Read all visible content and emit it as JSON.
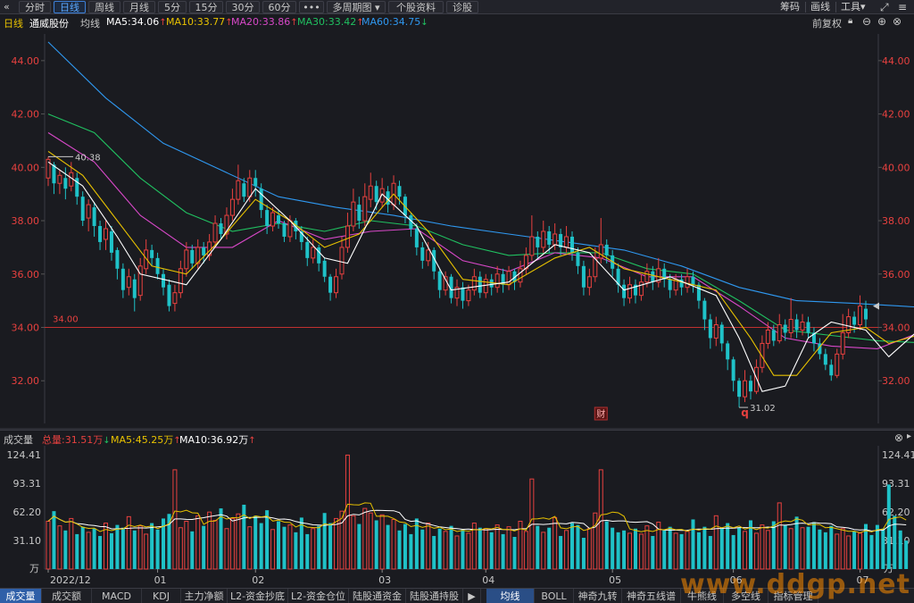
{
  "toolbar": {
    "back_icon": "«",
    "periods": [
      "分时",
      "日线",
      "周线",
      "月线",
      "5分",
      "15分",
      "30分",
      "60分"
    ],
    "active_period": "日线",
    "more": "•••",
    "multi_period": "多周期图",
    "profile": "个股资料",
    "diagnose": "诊股",
    "right": [
      "筹码",
      "画线",
      "工具"
    ],
    "dropdown_icon": "▾"
  },
  "info": {
    "period": "日线",
    "name": "通威股份",
    "ma_label": "均线",
    "ma5": "MA5:34.06",
    "ma10": "MA10:33.77",
    "ma20": "MA20:33.86",
    "ma30": "MA30:33.42",
    "ma60": "MA60:34.75",
    "adjust": "前复权"
  },
  "colors": {
    "up": "#e8413f",
    "down": "#1fc2c8",
    "ma5": "#ffffff",
    "ma10": "#e8c200",
    "ma20": "#d848c8",
    "ma30": "#20c060",
    "ma60": "#2f98f0",
    "price_axis": "#e8413f",
    "ref_line": "#c03030"
  },
  "chart_data": {
    "type": "candlestick",
    "price_axis": {
      "ticks": [
        "44.00",
        "42.00",
        "40.00",
        "38.00",
        "36.00",
        "34.00",
        "32.00"
      ],
      "ylim": [
        30.4,
        45.0
      ]
    },
    "ref_line": {
      "value": 34.0,
      "label": "34.00"
    },
    "annotations": {
      "high": "40.38",
      "low": "31.02",
      "event1": "财",
      "event2": "q"
    },
    "x_labels": [
      "2022/12",
      "01",
      "02",
      "03",
      "04",
      "05",
      "06",
      "07"
    ],
    "x_label_index": [
      0,
      19,
      36,
      58,
      76,
      98,
      119,
      141
    ],
    "candles": [
      [
        39.6,
        40.3,
        40.4,
        39.3
      ],
      [
        40.1,
        39.4,
        40.2,
        39.0
      ],
      [
        39.4,
        39.7,
        39.9,
        39.0
      ],
      [
        39.6,
        39.2,
        40.0,
        38.8
      ],
      [
        39.3,
        39.8,
        40.2,
        39.1
      ],
      [
        39.6,
        38.9,
        39.8,
        38.6
      ],
      [
        38.9,
        38.0,
        39.1,
        37.8
      ],
      [
        38.1,
        38.6,
        38.8,
        37.6
      ],
      [
        38.5,
        37.8,
        38.7,
        37.4
      ],
      [
        37.8,
        37.2,
        38.0,
        36.9
      ],
      [
        37.3,
        37.7,
        38.0,
        36.9
      ],
      [
        37.6,
        36.8,
        37.8,
        36.5
      ],
      [
        36.9,
        36.2,
        37.0,
        35.8
      ],
      [
        36.2,
        35.4,
        36.4,
        35.1
      ],
      [
        35.5,
        35.9,
        36.2,
        35.2
      ],
      [
        35.8,
        35.1,
        36.0,
        34.6
      ],
      [
        35.2,
        36.3,
        36.6,
        35.0
      ],
      [
        36.2,
        36.9,
        37.3,
        36.0
      ],
      [
        36.9,
        36.6,
        37.1,
        36.3
      ],
      [
        36.6,
        36.0,
        36.8,
        35.8
      ],
      [
        36.0,
        35.5,
        36.2,
        35.2
      ],
      [
        35.6,
        34.8,
        35.8,
        34.6
      ],
      [
        34.9,
        35.3,
        35.6,
        34.6
      ],
      [
        35.3,
        36.2,
        36.5,
        35.1
      ],
      [
        36.2,
        36.9,
        37.2,
        35.9
      ],
      [
        36.9,
        36.4,
        37.1,
        36.2
      ],
      [
        36.4,
        37.0,
        37.3,
        36.2
      ],
      [
        37.0,
        36.7,
        37.2,
        36.4
      ],
      [
        36.7,
        37.2,
        37.5,
        36.5
      ],
      [
        37.2,
        37.9,
        38.2,
        37.0
      ],
      [
        37.9,
        37.5,
        38.1,
        37.3
      ],
      [
        37.5,
        38.2,
        38.5,
        37.3
      ],
      [
        38.2,
        38.8,
        39.2,
        38.0
      ],
      [
        38.8,
        39.5,
        40.1,
        38.6
      ],
      [
        39.4,
        38.9,
        39.6,
        38.7
      ],
      [
        38.9,
        39.6,
        39.9,
        38.7
      ],
      [
        39.6,
        39.3,
        39.9,
        38.9
      ],
      [
        39.2,
        38.4,
        39.4,
        38.1
      ],
      [
        38.4,
        37.8,
        38.6,
        37.5
      ],
      [
        37.8,
        38.3,
        38.5,
        37.6
      ],
      [
        38.2,
        37.9,
        38.4,
        37.7
      ],
      [
        37.9,
        37.4,
        38.0,
        37.2
      ],
      [
        37.4,
        38.0,
        38.2,
        37.2
      ],
      [
        38.0,
        37.6,
        38.1,
        37.3
      ],
      [
        37.6,
        37.2,
        37.8,
        36.9
      ],
      [
        37.2,
        36.6,
        37.4,
        36.3
      ],
      [
        36.6,
        37.0,
        37.3,
        36.4
      ],
      [
        37.0,
        36.4,
        37.1,
        36.1
      ],
      [
        36.5,
        35.9,
        36.6,
        35.7
      ],
      [
        35.9,
        35.3,
        36.0,
        35.0
      ],
      [
        35.3,
        35.9,
        36.2,
        35.1
      ],
      [
        36.0,
        37.0,
        37.4,
        35.8
      ],
      [
        37.0,
        37.8,
        38.3,
        36.8
      ],
      [
        37.8,
        38.7,
        39.2,
        37.6
      ],
      [
        38.6,
        38.0,
        38.9,
        37.7
      ],
      [
        38.0,
        38.9,
        39.4,
        37.8
      ],
      [
        38.8,
        39.3,
        39.8,
        38.5
      ],
      [
        39.3,
        38.7,
        39.5,
        38.4
      ],
      [
        38.7,
        39.2,
        39.6,
        38.5
      ],
      [
        39.1,
        38.6,
        39.3,
        38.3
      ],
      [
        38.6,
        39.4,
        39.7,
        38.4
      ],
      [
        39.3,
        38.9,
        39.5,
        38.6
      ],
      [
        38.9,
        38.2,
        39.0,
        37.9
      ],
      [
        38.2,
        37.7,
        38.3,
        37.4
      ],
      [
        37.7,
        37.0,
        37.9,
        36.7
      ],
      [
        37.0,
        36.5,
        37.2,
        36.2
      ],
      [
        36.5,
        36.9,
        37.2,
        36.3
      ],
      [
        36.9,
        36.1,
        37.0,
        35.8
      ],
      [
        36.1,
        35.4,
        36.2,
        35.1
      ],
      [
        35.4,
        35.9,
        36.1,
        35.2
      ],
      [
        35.9,
        35.1,
        36.0,
        34.9
      ],
      [
        35.1,
        35.5,
        35.8,
        34.8
      ],
      [
        35.5,
        35.0,
        35.7,
        34.7
      ],
      [
        35.0,
        35.4,
        35.6,
        34.8
      ],
      [
        35.4,
        35.9,
        36.2,
        35.2
      ],
      [
        35.9,
        35.3,
        36.1,
        35.1
      ],
      [
        35.3,
        35.8,
        36.0,
        35.1
      ],
      [
        35.8,
        35.5,
        36.0,
        35.2
      ],
      [
        35.5,
        36.0,
        36.3,
        35.3
      ],
      [
        36.0,
        35.6,
        36.2,
        35.3
      ],
      [
        35.6,
        36.1,
        36.3,
        35.4
      ],
      [
        36.1,
        35.7,
        36.2,
        35.4
      ],
      [
        35.7,
        36.2,
        36.5,
        35.5
      ],
      [
        36.2,
        36.7,
        37.0,
        36.0
      ],
      [
        36.7,
        37.4,
        38.2,
        36.5
      ],
      [
        37.4,
        37.0,
        37.6,
        36.6
      ],
      [
        37.0,
        37.6,
        38.0,
        36.8
      ],
      [
        37.6,
        37.1,
        37.8,
        36.8
      ],
      [
        37.1,
        37.5,
        37.9,
        36.9
      ],
      [
        37.5,
        37.0,
        37.7,
        36.7
      ],
      [
        37.0,
        37.4,
        37.8,
        36.8
      ],
      [
        37.4,
        36.8,
        37.6,
        36.5
      ],
      [
        36.8,
        36.3,
        37.0,
        36.0
      ],
      [
        36.3,
        35.5,
        36.5,
        35.2
      ],
      [
        35.5,
        35.9,
        36.2,
        35.2
      ],
      [
        35.9,
        36.6,
        37.0,
        35.7
      ],
      [
        36.6,
        37.1,
        38.1,
        36.4
      ],
      [
        37.1,
        36.7,
        37.3,
        36.4
      ],
      [
        36.7,
        36.2,
        36.9,
        35.9
      ],
      [
        36.2,
        35.6,
        36.4,
        35.3
      ],
      [
        35.6,
        35.1,
        35.8,
        34.8
      ],
      [
        35.1,
        35.6,
        35.9,
        34.9
      ],
      [
        35.6,
        35.2,
        35.8,
        34.9
      ],
      [
        35.2,
        35.7,
        36.0,
        35.0
      ],
      [
        35.7,
        36.1,
        36.4,
        35.5
      ],
      [
        36.1,
        35.7,
        36.3,
        35.4
      ],
      [
        35.7,
        36.2,
        36.6,
        35.5
      ],
      [
        36.2,
        35.8,
        36.4,
        35.5
      ],
      [
        35.8,
        35.4,
        36.0,
        35.1
      ],
      [
        35.4,
        35.8,
        36.0,
        35.2
      ],
      [
        35.8,
        35.5,
        36.0,
        35.2
      ],
      [
        35.5,
        35.9,
        36.2,
        35.3
      ],
      [
        35.9,
        35.6,
        36.1,
        35.3
      ],
      [
        35.6,
        35.0,
        35.7,
        34.7
      ],
      [
        35.0,
        34.3,
        35.1,
        33.9
      ],
      [
        34.3,
        33.6,
        34.5,
        33.2
      ],
      [
        33.6,
        34.1,
        34.4,
        33.3
      ],
      [
        34.1,
        33.4,
        34.2,
        33.1
      ],
      [
        33.4,
        32.8,
        33.5,
        32.4
      ],
      [
        32.8,
        32.0,
        32.9,
        31.6
      ],
      [
        32.0,
        31.4,
        32.1,
        31.0
      ],
      [
        31.4,
        32.0,
        32.4,
        31.2
      ],
      [
        32.0,
        31.6,
        32.2,
        31.3
      ],
      [
        31.6,
        32.5,
        32.8,
        31.5
      ],
      [
        32.5,
        33.4,
        33.7,
        32.3
      ],
      [
        33.4,
        33.9,
        34.2,
        33.2
      ],
      [
        33.9,
        33.5,
        34.1,
        33.3
      ],
      [
        33.5,
        34.1,
        34.5,
        33.4
      ],
      [
        34.1,
        33.8,
        34.3,
        33.5
      ],
      [
        33.8,
        34.3,
        35.1,
        33.6
      ],
      [
        34.3,
        33.9,
        34.5,
        33.6
      ],
      [
        33.9,
        34.2,
        34.5,
        33.7
      ],
      [
        34.2,
        33.8,
        34.4,
        33.6
      ],
      [
        33.8,
        33.4,
        34.0,
        33.1
      ],
      [
        33.4,
        33.0,
        33.6,
        32.8
      ],
      [
        33.0,
        32.6,
        33.2,
        32.4
      ],
      [
        32.6,
        32.2,
        32.8,
        32.0
      ],
      [
        32.2,
        33.0,
        33.2,
        32.1
      ],
      [
        33.0,
        33.8,
        34.5,
        32.8
      ],
      [
        33.8,
        34.4,
        34.7,
        33.6
      ],
      [
        34.4,
        34.1,
        34.6,
        33.8
      ],
      [
        34.1,
        34.8,
        35.2,
        33.9
      ],
      [
        34.7,
        34.3,
        35.0,
        34.0
      ]
    ],
    "ma_series_names": [
      "MA5",
      "MA10",
      "MA20",
      "MA30",
      "MA60"
    ],
    "ma60_pts": [
      [
        0,
        44.7
      ],
      [
        10,
        42.6
      ],
      [
        20,
        40.9
      ],
      [
        30,
        39.9
      ],
      [
        40,
        38.9
      ],
      [
        50,
        38.5
      ],
      [
        60,
        38.2
      ],
      [
        70,
        37.8
      ],
      [
        80,
        37.5
      ],
      [
        90,
        37.2
      ],
      [
        100,
        36.9
      ],
      [
        110,
        36.3
      ],
      [
        120,
        35.5
      ],
      [
        130,
        35.0
      ],
      [
        140,
        34.9
      ],
      [
        152,
        34.75
      ]
    ],
    "ma30_pts": [
      [
        0,
        42.0
      ],
      [
        8,
        41.3
      ],
      [
        16,
        39.6
      ],
      [
        24,
        38.3
      ],
      [
        32,
        37.6
      ],
      [
        40,
        37.9
      ],
      [
        48,
        37.6
      ],
      [
        56,
        38.0
      ],
      [
        64,
        37.8
      ],
      [
        72,
        37.1
      ],
      [
        80,
        36.7
      ],
      [
        88,
        36.8
      ],
      [
        96,
        36.8
      ],
      [
        104,
        36.2
      ],
      [
        112,
        36.0
      ],
      [
        120,
        35.0
      ],
      [
        128,
        33.9
      ],
      [
        136,
        33.7
      ],
      [
        144,
        33.5
      ],
      [
        152,
        33.42
      ]
    ],
    "ma20_pts": [
      [
        0,
        41.3
      ],
      [
        8,
        40.2
      ],
      [
        16,
        38.2
      ],
      [
        24,
        37.0
      ],
      [
        32,
        37.0
      ],
      [
        40,
        38.0
      ],
      [
        48,
        37.3
      ],
      [
        56,
        37.6
      ],
      [
        64,
        37.7
      ],
      [
        72,
        36.5
      ],
      [
        80,
        36.1
      ],
      [
        88,
        36.8
      ],
      [
        96,
        36.6
      ],
      [
        104,
        35.9
      ],
      [
        112,
        35.9
      ],
      [
        120,
        34.8
      ],
      [
        128,
        33.6
      ],
      [
        136,
        33.3
      ],
      [
        144,
        33.2
      ],
      [
        152,
        33.86
      ]
    ],
    "ma10_pts": [
      [
        0,
        40.6
      ],
      [
        6,
        39.7
      ],
      [
        12,
        38.0
      ],
      [
        18,
        36.3
      ],
      [
        24,
        36.0
      ],
      [
        30,
        37.3
      ],
      [
        36,
        38.8
      ],
      [
        42,
        38.0
      ],
      [
        48,
        37.0
      ],
      [
        54,
        37.5
      ],
      [
        60,
        39.0
      ],
      [
        66,
        37.6
      ],
      [
        72,
        35.8
      ],
      [
        80,
        35.6
      ],
      [
        88,
        36.6
      ],
      [
        94,
        37.0
      ],
      [
        100,
        36.2
      ],
      [
        108,
        35.8
      ],
      [
        116,
        35.4
      ],
      [
        122,
        33.6
      ],
      [
        126,
        32.2
      ],
      [
        130,
        32.2
      ],
      [
        136,
        33.8
      ],
      [
        142,
        34.0
      ],
      [
        146,
        33.4
      ],
      [
        152,
        33.77
      ]
    ],
    "ma5_pts": [
      [
        0,
        40.2
      ],
      [
        6,
        39.3
      ],
      [
        12,
        37.4
      ],
      [
        16,
        36.0
      ],
      [
        20,
        35.8
      ],
      [
        24,
        35.6
      ],
      [
        30,
        37.3
      ],
      [
        36,
        39.2
      ],
      [
        42,
        38.0
      ],
      [
        48,
        36.6
      ],
      [
        52,
        36.4
      ],
      [
        58,
        39.0
      ],
      [
        64,
        37.8
      ],
      [
        70,
        35.4
      ],
      [
        80,
        35.7
      ],
      [
        88,
        37.1
      ],
      [
        94,
        36.8
      ],
      [
        100,
        35.4
      ],
      [
        108,
        35.9
      ],
      [
        116,
        35.2
      ],
      [
        120,
        33.6
      ],
      [
        124,
        31.6
      ],
      [
        128,
        31.8
      ],
      [
        132,
        33.6
      ],
      [
        136,
        34.2
      ],
      [
        142,
        33.9
      ],
      [
        146,
        32.9
      ],
      [
        152,
        34.06
      ]
    ],
    "volume": {
      "header_label": "成交量",
      "total": "总量:31.51万",
      "ma5": "MA5:45.25万",
      "ma10": "MA10:36.92万",
      "ticks": [
        "124.41",
        "93.31",
        "62.20",
        "31.10"
      ],
      "unit": "万",
      "ylim": [
        0,
        124.41
      ],
      "values": [
        52,
        63,
        47,
        42,
        55,
        38,
        46,
        40,
        44,
        36,
        50,
        39,
        48,
        45,
        57,
        42,
        47,
        38,
        50,
        43,
        55,
        60,
        108,
        45,
        52,
        41,
        58,
        47,
        62,
        53,
        66,
        44,
        55,
        60,
        70,
        46,
        58,
        50,
        64,
        43,
        52,
        46,
        48,
        40,
        56,
        38,
        44,
        47,
        61,
        50,
        55,
        63,
        124,
        58,
        49,
        66,
        61,
        53,
        59,
        48,
        54,
        42,
        49,
        38,
        55,
        43,
        50,
        36,
        44,
        41,
        47,
        36,
        43,
        39,
        50,
        45,
        44,
        40,
        48,
        38,
        46,
        35,
        52,
        41,
        98,
        47,
        40,
        45,
        56,
        36,
        42,
        50,
        48,
        34,
        44,
        61,
        108,
        52,
        45,
        40,
        42,
        39,
        44,
        38,
        47,
        36,
        51,
        42,
        46,
        39,
        38,
        41,
        54,
        40,
        46,
        36,
        58,
        44,
        50,
        37,
        45,
        41,
        53,
        39,
        48,
        42,
        52,
        72,
        48,
        44,
        57,
        45,
        46,
        51,
        43,
        40,
        47,
        38,
        44,
        36,
        41,
        39,
        49,
        37,
        48,
        44,
        92,
        58,
        42,
        31
      ]
    }
  },
  "bottom_tabs": [
    "成交量",
    "成交额",
    "MACD",
    "KDJ",
    "主力净额",
    "L2-资金抄底",
    "L2-资金仓位",
    "陆股通资金",
    "陆股通持股",
    "均线",
    "BOLL",
    "神奇九转",
    "神奇五线谱",
    "牛熊线",
    "多空线",
    "指标管理"
  ],
  "bottom_more": "▶",
  "watermark": "www.ddgp.net"
}
